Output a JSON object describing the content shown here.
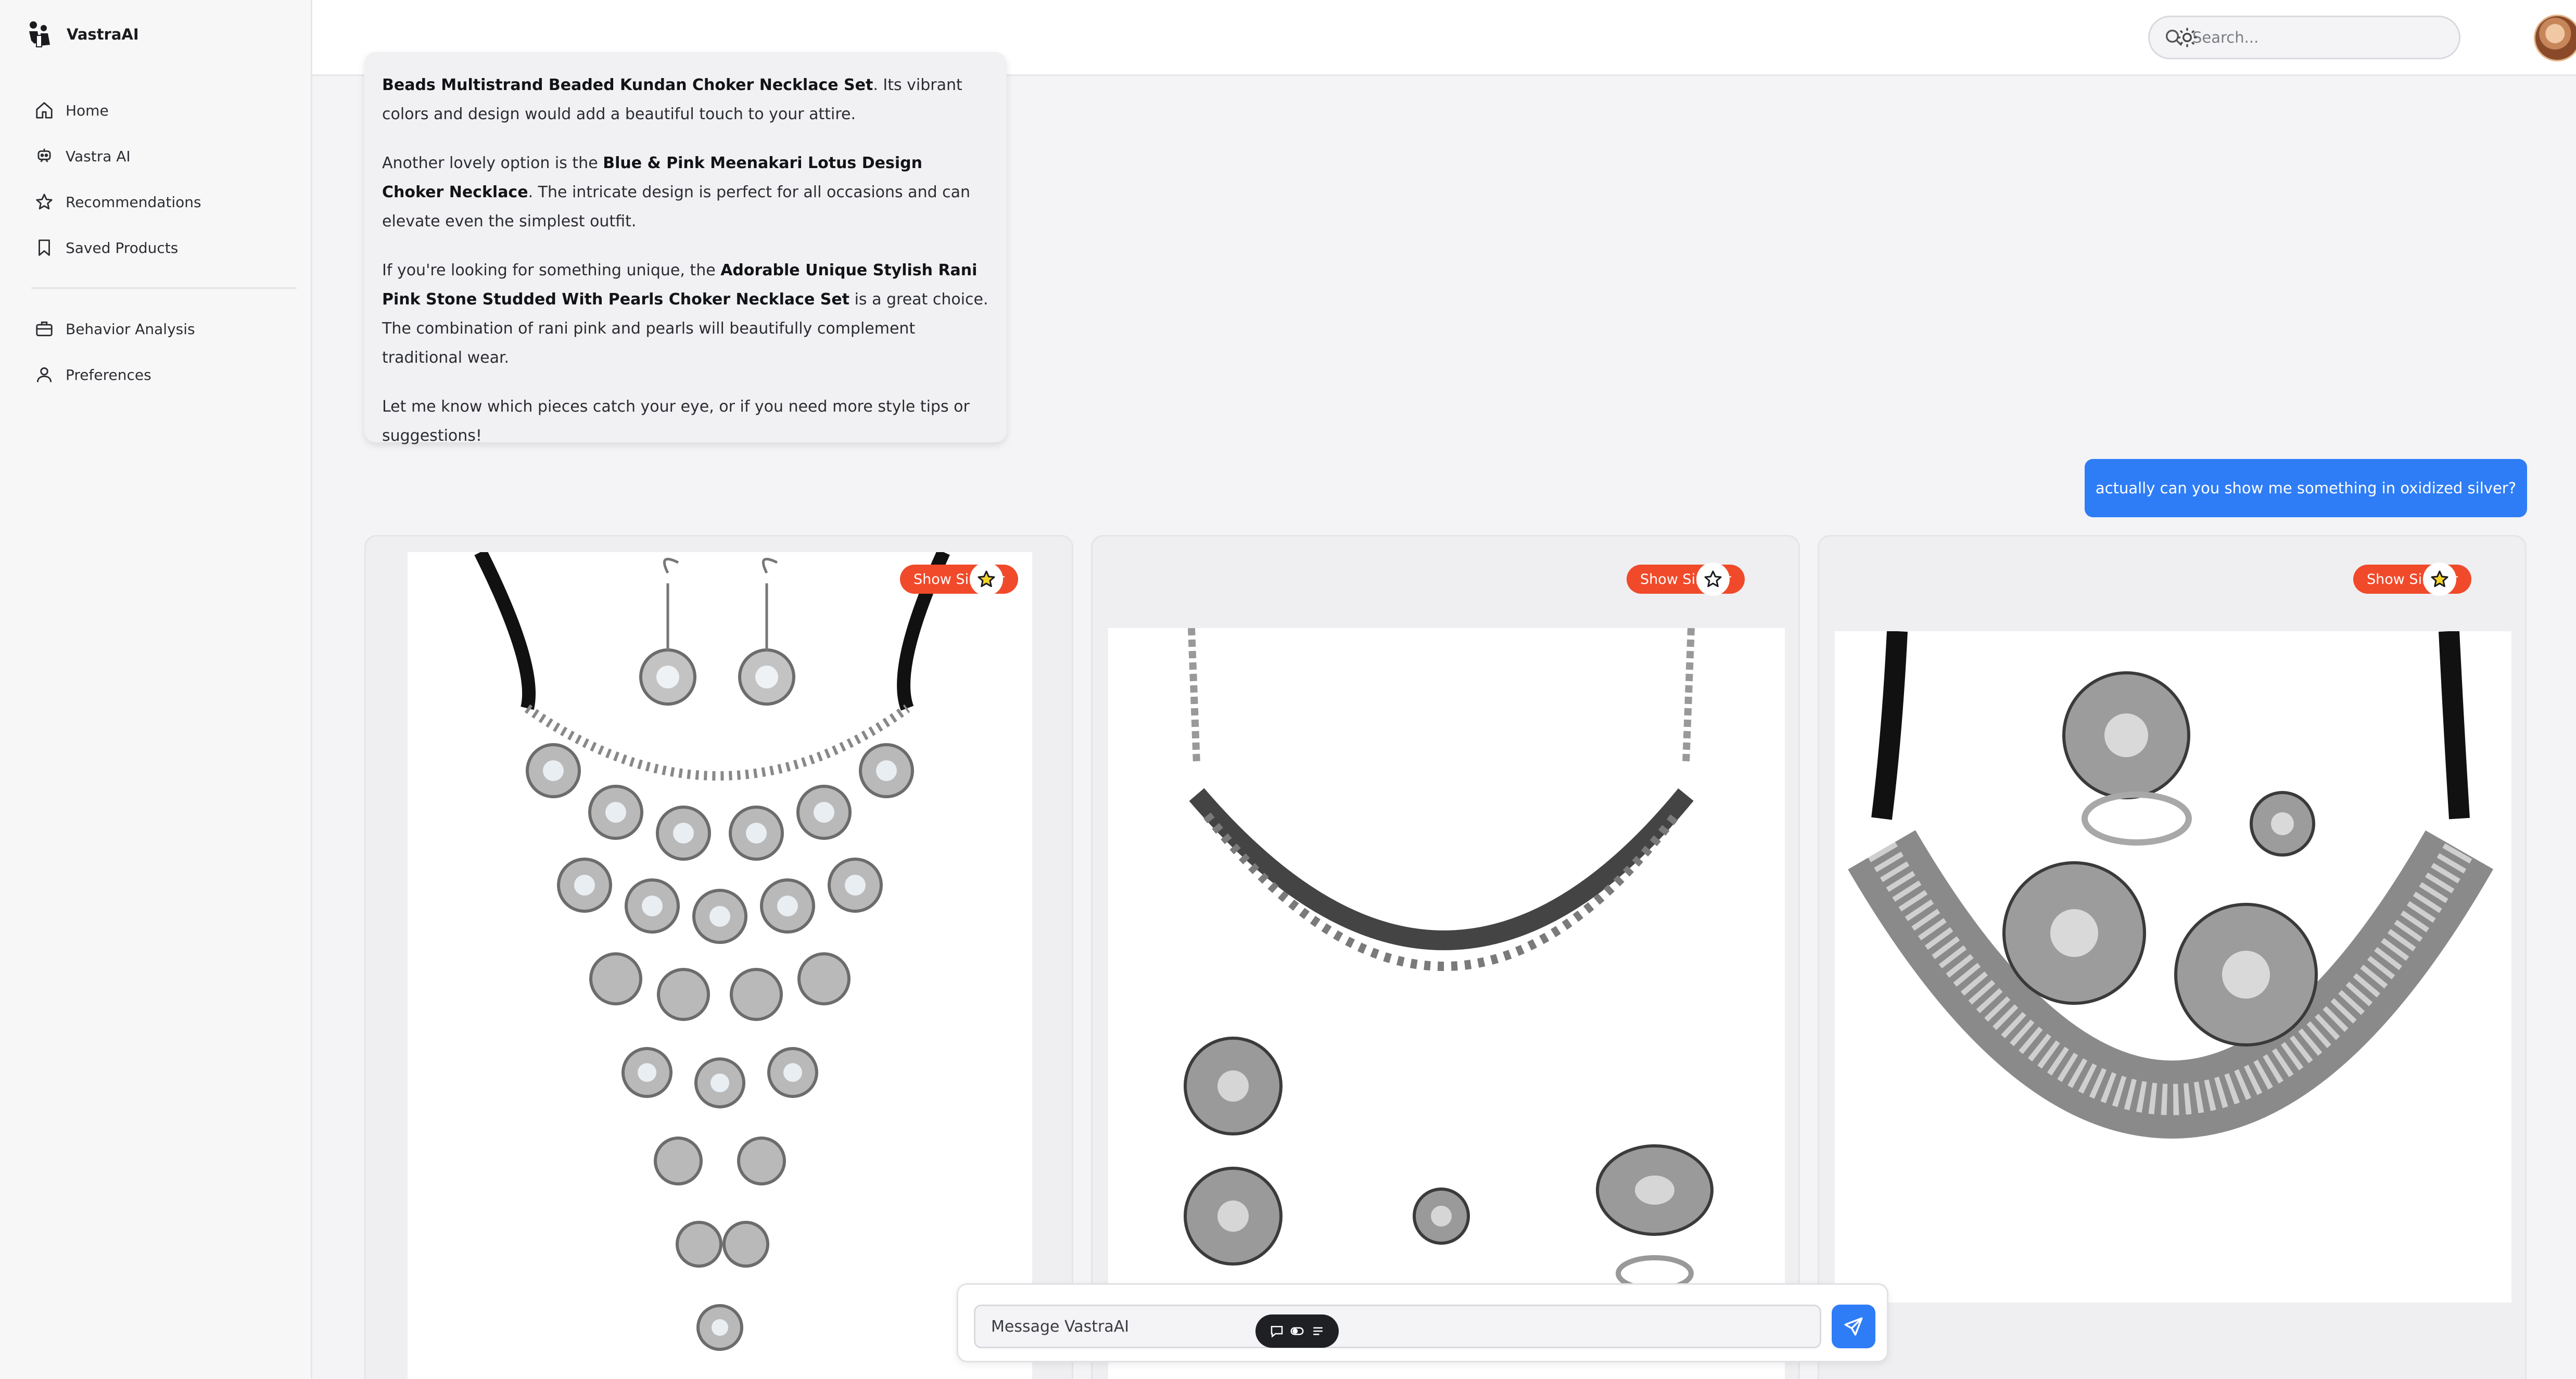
{
  "app": {
    "name": "VastraAI"
  },
  "sidebar": {
    "primary": [
      {
        "label": "Home",
        "icon": "home-icon"
      },
      {
        "label": "Vastra AI",
        "icon": "bot-icon"
      },
      {
        "label": "Recommendations",
        "icon": "star-icon"
      },
      {
        "label": "Saved Products",
        "icon": "bookmark-icon"
      }
    ],
    "secondary": [
      {
        "label": "Behavior Analysis",
        "icon": "briefcase-icon"
      },
      {
        "label": "Preferences",
        "icon": "user-icon"
      }
    ]
  },
  "topbar": {
    "search_placeholder": "Search...",
    "theme_icon": "sun-icon",
    "avatar": "avatar"
  },
  "chat": {
    "assistant": {
      "p1_bold": "Beads Multistrand Beaded Kundan Choker Necklace Set",
      "p1_text": ". Its vibrant colors and design would add a beautiful touch to your attire.",
      "p2_pre": "Another lovely option is the ",
      "p2_bold": "Blue & Pink Meenakari Lotus Design Choker Necklace",
      "p2_post": ". The intricate design is perfect for all occasions and can elevate even the simplest outfit.",
      "p3_pre": "If you're looking for something unique, the ",
      "p3_bold": "Adorable Unique Stylish Rani Pink Stone Studded With Pearls Choker Necklace Set",
      "p3_post": " is a great choice. The combination of rani pink and pearls will beautifully complement traditional wear.",
      "p4": "Let me know which pieces catch your eye, or if you need more style tips or suggestions!"
    },
    "user": {
      "text": "actually can you show me something in oxidized silver?"
    }
  },
  "products": [
    {
      "show_similar_label": "Show Similar",
      "star_icon": "star-icon",
      "image": "oxidized-mirror-bib-necklace-with-earrings"
    },
    {
      "show_similar_label": "Show Similar",
      "star_icon": "star-icon",
      "image": "oxidized-choker-with-earrings-nosepin-ring"
    },
    {
      "show_similar_label": "Show Similar",
      "star_icon": "star-icon",
      "image": "oxidized-collar-necklace-with-earrings-rings"
    }
  ],
  "composer": {
    "placeholder": "Message VastraAI",
    "send_icon": "send-icon",
    "mode_icons": [
      "chat-bubble-icon",
      "toggle-icon",
      "list-icon"
    ]
  },
  "colors": {
    "accent": "#2f7df6",
    "show_similar": "#f04a2a",
    "star_fill": "#f6d32b",
    "sidebar_bg": "#f7f7f8"
  }
}
